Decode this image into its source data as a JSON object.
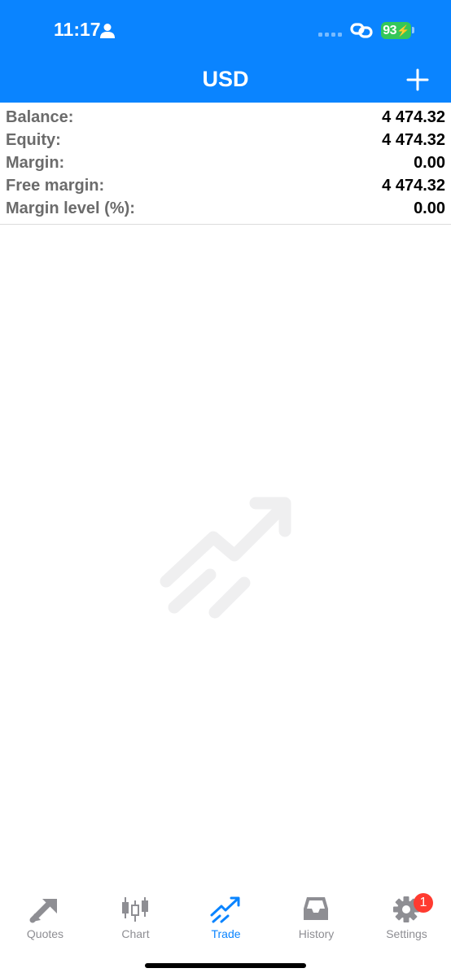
{
  "status_bar": {
    "time": "11:17",
    "battery": "93"
  },
  "header": {
    "title": "USD"
  },
  "account": {
    "rows": [
      {
        "label": "Balance:",
        "value": "4 474.32"
      },
      {
        "label": "Equity:",
        "value": "4 474.32"
      },
      {
        "label": "Margin:",
        "value": "0.00"
      },
      {
        "label": "Free margin:",
        "value": "4 474.32"
      },
      {
        "label": "Margin level (%):",
        "value": "0.00"
      }
    ]
  },
  "tabbar": {
    "tabs": [
      {
        "label": "Quotes",
        "icon": "quotes-icon"
      },
      {
        "label": "Chart",
        "icon": "candlestick-chart-icon"
      },
      {
        "label": "Trade",
        "icon": "trade-arrow-icon",
        "active": true
      },
      {
        "label": "History",
        "icon": "inbox-tray-icon"
      },
      {
        "label": "Settings",
        "icon": "gear-icon"
      }
    ],
    "settings_badge": "1"
  },
  "colors": {
    "header": "#0a84ff",
    "active_tab": "#0a84ff",
    "inactive_tab": "#8e8e93",
    "battery": "#34c759",
    "badge": "#ff3b30"
  }
}
